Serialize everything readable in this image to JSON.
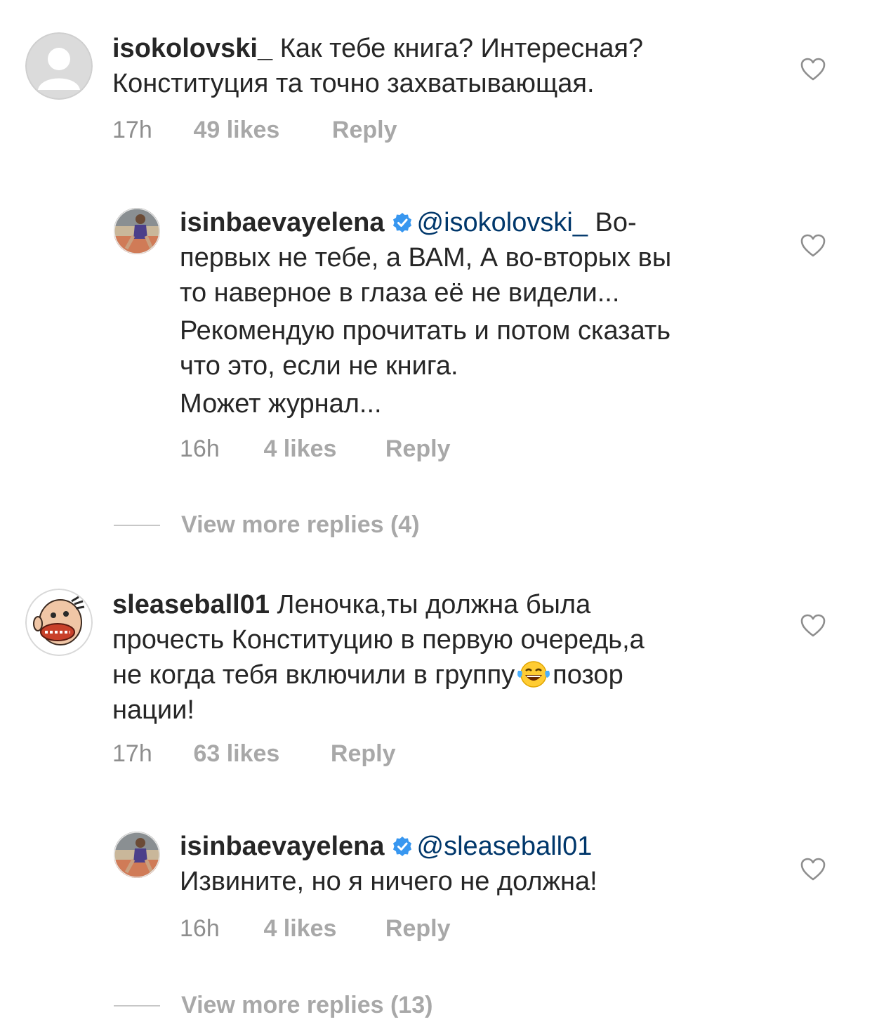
{
  "comments": [
    {
      "username": "isokolovski_",
      "text_lines": [
        "Как тебе книга? Интересная?",
        "Конституция та точно захватывающая."
      ],
      "time": "17h",
      "likes": "49 likes",
      "reply": "Reply",
      "replies": [
        {
          "username": "isinbaevayelena",
          "verified": true,
          "mention": "@isokolovski_",
          "text_lines": [
            "Во-",
            "первых не тебе, а ВАМ, А во-вторых вы",
            "то наверное  в глаза её не видели...",
            "Рекомендую прочитать и потом сказать",
            "что это, если не книга.",
            "Может журнал..."
          ],
          "time": "16h",
          "likes": "4 likes",
          "reply": "Reply"
        }
      ],
      "view_more": "View more replies (4)"
    },
    {
      "username": "sleaseball01",
      "text_lines": [
        "Леночка,ты должна была",
        "прочесть Конституцию в первую очередь,а",
        "не когда тебя включили в группу",
        "позор",
        "нации!"
      ],
      "emoji": "face-with-tears-of-joy",
      "time": "17h",
      "likes": "63 likes",
      "reply": "Reply",
      "replies": [
        {
          "username": "isinbaevayelena",
          "verified": true,
          "mention": "@sleaseball01",
          "text_lines": [
            "Извините, но я ничего не должна!"
          ],
          "time": "16h",
          "likes": "4 likes",
          "reply": "Reply"
        }
      ],
      "view_more": "View more replies (13)"
    }
  ],
  "icons": {
    "like": "heart-outline-icon",
    "verified": "verified-badge-icon"
  },
  "colors": {
    "text": "#262626",
    "meta": "#8e8e8e",
    "mention": "#00376b",
    "verified": "#3897f0"
  }
}
